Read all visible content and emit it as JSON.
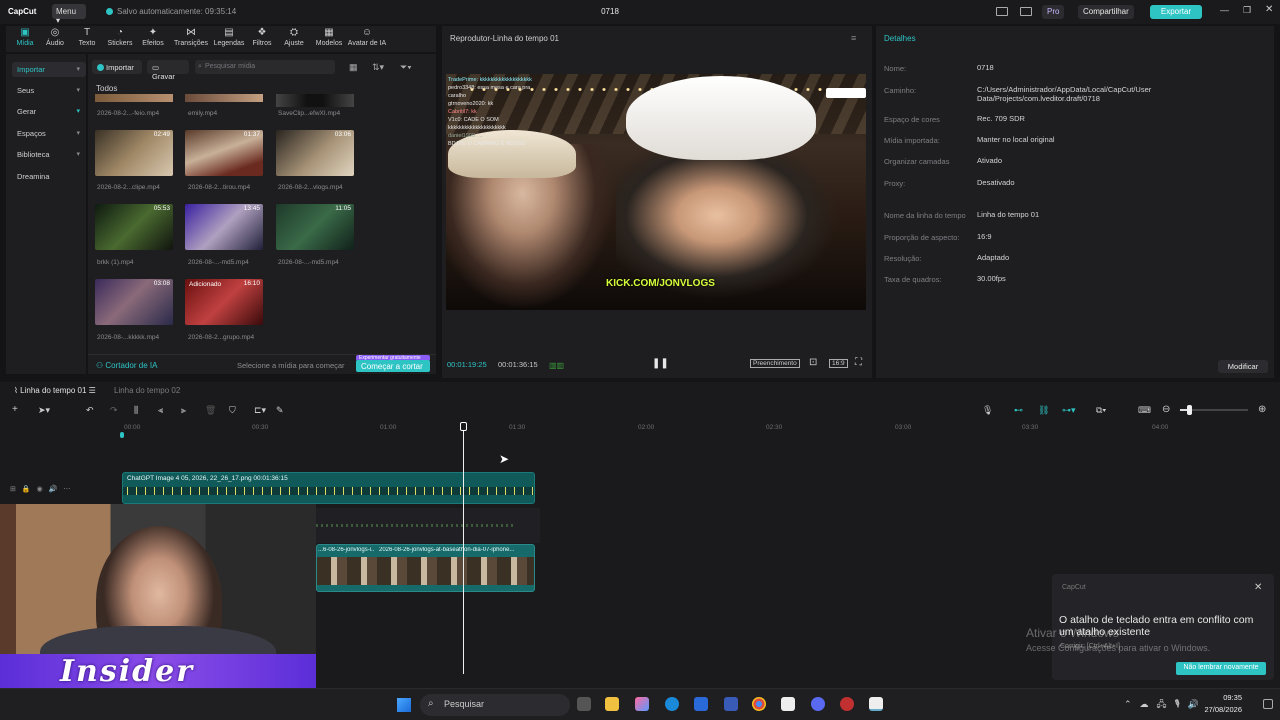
{
  "app": {
    "logo": "CapCut",
    "menu": "Menu",
    "autosave": "Salvo automaticamente: 09:35:14",
    "project": "0718"
  },
  "titlebar": {
    "pro": "Pro",
    "share": "Compartilhar",
    "export": "Exportar",
    "accent": "#2ec4c4"
  },
  "tabs": [
    {
      "label": "Mídia",
      "icon": "media-icon"
    },
    {
      "label": "Áudio",
      "icon": "audio-icon"
    },
    {
      "label": "Texto",
      "icon": "text-icon"
    },
    {
      "label": "Stickers",
      "icon": "sticker-icon"
    },
    {
      "label": "Efeitos",
      "icon": "effects-icon"
    },
    {
      "label": "Transições",
      "icon": "transitions-icon"
    },
    {
      "label": "Legendas",
      "icon": "captions-icon"
    },
    {
      "label": "Filtros",
      "icon": "filters-icon"
    },
    {
      "label": "Ajuste",
      "icon": "adjust-icon"
    },
    {
      "label": "Modelos",
      "icon": "templates-icon"
    },
    {
      "label": "Avatar de IA",
      "icon": "ai-avatar-icon"
    }
  ],
  "sidebar": {
    "items": [
      "Importar",
      "Seus",
      "Gerar",
      "Espaços",
      "Biblioteca",
      "Dreamina"
    ]
  },
  "media": {
    "import": "Importar",
    "record": "Gravar",
    "search_placeholder": "Pesquisar mídia",
    "section": "Todos",
    "row0": [
      "2026-08-2...-feio.mp4",
      "emily.mp4",
      "SaveClip...efwXI.mp4"
    ],
    "items": [
      {
        "name": "2026-08-2...clipe.mp4",
        "dur": "02:49"
      },
      {
        "name": "2026-08-2...tirou.mp4",
        "dur": "01:37"
      },
      {
        "name": "2026-08-2...vlogs.mp4",
        "dur": "03:06"
      },
      {
        "name": "brkk (1).mp4",
        "dur": "05:53"
      },
      {
        "name": "2026-08-...-md5.mp4",
        "dur": "13:45"
      },
      {
        "name": "2026-08-...-md5.mp4",
        "dur": "11:05"
      },
      {
        "name": "2026-08-...kkkkk.mp4",
        "dur": "03:08"
      },
      {
        "name": "2026-08-2...grupo.mp4",
        "dur": "16:10",
        "badge": "Adicionado"
      }
    ],
    "ai_cutter": "Cortador de IA",
    "select_hint": "Selecione a mídia para começar",
    "free_badge": "Experimentar gratuitamente",
    "start_cut": "Começar a cortar"
  },
  "player": {
    "title": "Reprodutor-Linha do tempo 01",
    "current": "00:01:19:25",
    "total": "00:01:36:15",
    "fill": "Preenchimento",
    "ratio": "16:9",
    "overlay_text": "KICK.COM/JONVLOGS",
    "chat_lines": [
      "TradePrime: kkkkkkkkkkkkkkkkkkk",
      "pedro3348: essa mesa e cara pra",
      "caralho",
      "gtrnoveno2020: kk",
      "Cabritil7: kk",
      "V1c0: CADE O SOM",
      "kkkkkkkkkkkkkkkkkkkkk",
      "daniel1900: ...",
      "BDJ7n: O CAMPING É NOSSO"
    ]
  },
  "details": {
    "title": "Detalhes",
    "rows": [
      {
        "k": "Nome:",
        "v": "0718"
      },
      {
        "k": "Caminho:",
        "v": "C:/Users/Administrador/AppData/Local/CapCut/User Data/Projects/com.lveditor.draft/0718"
      },
      {
        "k": "Espaço de cores",
        "v": "Rec. 709 SDR"
      },
      {
        "k": "Mídia importada:",
        "v": "Manter no local original"
      },
      {
        "k": "Organizar camadas",
        "v": "Ativado"
      },
      {
        "k": "Proxy:",
        "v": "Desativado"
      },
      {
        "k": "Nome da linha do tempo",
        "v": "Linha do tempo 01"
      },
      {
        "k": "Proporção de aspecto:",
        "v": "16:9"
      },
      {
        "k": "Resolução:",
        "v": "Adaptado"
      },
      {
        "k": "Taxa de quadros:",
        "v": "30.00fps"
      }
    ],
    "modify": "Modificar"
  },
  "timeline": {
    "tab1": "Linha do tempo 01",
    "tab2": "Linha do tempo 02",
    "ruler": [
      "00:00",
      "00:30",
      "01:00",
      "01:30",
      "02:00",
      "02:30",
      "03:00",
      "03:30",
      "04:00"
    ],
    "clip1": "ChatGPT Image 4 05, 2026, 22_26_17.png   00:01:36:15",
    "clip2a": "...6-08-26-jonvlogs-i...",
    "clip2b": "2026-08-26-jonvlogs-at-baseathon-dia-07-iphone..."
  },
  "toast": {
    "app": "CapCut",
    "message": "O atalho de teclado entra em conflito com um atalho existente",
    "shortcut": "Corrigir: [Ctrl+Alt+I]",
    "dismiss": "Não lembrar novamente"
  },
  "watermark": {
    "line1": "Ativar o Windows",
    "line2": "Acesse Configurações para ativar o Windows."
  },
  "overlay": {
    "brand": "Insider"
  },
  "taskbar": {
    "search": "Pesquisar",
    "time": "09:35",
    "date": "27/08/2026"
  }
}
